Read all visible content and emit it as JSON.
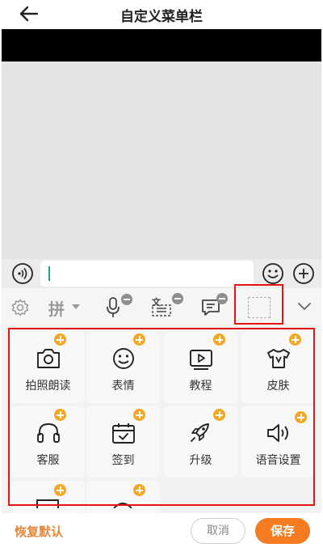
{
  "header": {
    "title": "自定义菜单栏",
    "back_icon": "arrow-left-icon"
  },
  "input_bar": {
    "placeholder": ""
  },
  "toolbar": {
    "items": [
      {
        "icon": "gear-icon"
      },
      {
        "icon": "pinyin-dropdown-icon",
        "label": "拼"
      },
      {
        "icon": "microphone-icon",
        "removable": true
      },
      {
        "icon": "ocr-text-icon",
        "removable": true
      },
      {
        "icon": "message-icon",
        "removable": true
      },
      {
        "icon": "empty-slot-icon"
      },
      {
        "icon": "chevron-down-icon"
      }
    ]
  },
  "grid": {
    "items": [
      {
        "label": "拍照朗读",
        "icon": "camera-icon"
      },
      {
        "label": "表情",
        "icon": "smile-icon"
      },
      {
        "label": "教程",
        "icon": "video-icon"
      },
      {
        "label": "皮肤",
        "icon": "tshirt-icon"
      },
      {
        "label": "客服",
        "icon": "headset-icon"
      },
      {
        "label": "签到",
        "icon": "calendar-check-icon"
      },
      {
        "label": "升级",
        "icon": "rocket-icon"
      },
      {
        "label": "语音设置",
        "icon": "speaker-icon"
      }
    ]
  },
  "footer": {
    "restore_label": "恢复默认",
    "cancel_label": "取消",
    "save_label": "保存"
  },
  "colors": {
    "accent": "#f47c20",
    "badge": "#f5a623",
    "highlight": "#e01515"
  }
}
